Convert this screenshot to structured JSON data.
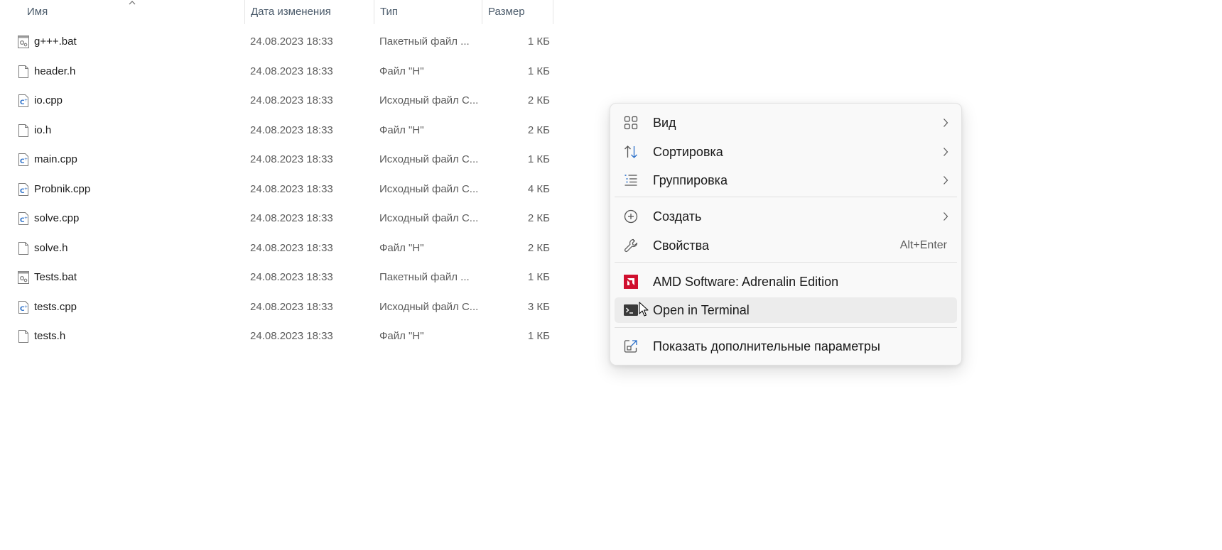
{
  "columns": {
    "name": "Имя",
    "date": "Дата изменения",
    "type": "Тип",
    "size": "Размер"
  },
  "files": [
    {
      "name": "g+++.bat",
      "date": "24.08.2023 18:33",
      "type": "Пакетный файл ...",
      "size": "1 КБ",
      "icon": "batch-file-icon"
    },
    {
      "name": "header.h",
      "date": "24.08.2023 18:33",
      "type": "Файл \"H\"",
      "size": "1 КБ",
      "icon": "blank-file-icon"
    },
    {
      "name": "io.cpp",
      "date": "24.08.2023 18:33",
      "type": "Исходный файл C...",
      "size": "2 КБ",
      "icon": "cpp-file-icon"
    },
    {
      "name": "io.h",
      "date": "24.08.2023 18:33",
      "type": "Файл \"H\"",
      "size": "2 КБ",
      "icon": "blank-file-icon"
    },
    {
      "name": "main.cpp",
      "date": "24.08.2023 18:33",
      "type": "Исходный файл C...",
      "size": "1 КБ",
      "icon": "cpp-file-icon"
    },
    {
      "name": "Probnik.cpp",
      "date": "24.08.2023 18:33",
      "type": "Исходный файл C...",
      "size": "4 КБ",
      "icon": "cpp-file-icon"
    },
    {
      "name": "solve.cpp",
      "date": "24.08.2023 18:33",
      "type": "Исходный файл C...",
      "size": "2 КБ",
      "icon": "cpp-file-icon"
    },
    {
      "name": "solve.h",
      "date": "24.08.2023 18:33",
      "type": "Файл \"H\"",
      "size": "2 КБ",
      "icon": "blank-file-icon"
    },
    {
      "name": "Tests.bat",
      "date": "24.08.2023 18:33",
      "type": "Пакетный файл ...",
      "size": "1 КБ",
      "icon": "batch-file-icon"
    },
    {
      "name": "tests.cpp",
      "date": "24.08.2023 18:33",
      "type": "Исходный файл C...",
      "size": "3 КБ",
      "icon": "cpp-file-icon"
    },
    {
      "name": "tests.h",
      "date": "24.08.2023 18:33",
      "type": "Файл \"H\"",
      "size": "1 КБ",
      "icon": "blank-file-icon"
    }
  ],
  "context_menu": {
    "items": [
      {
        "label": "Вид",
        "icon": "grid-view-icon",
        "submenu": true
      },
      {
        "label": "Сортировка",
        "icon": "sort-icon",
        "submenu": true
      },
      {
        "label": "Группировка",
        "icon": "group-list-icon",
        "submenu": true
      },
      {
        "label": "Создать",
        "icon": "plus-circle-icon",
        "submenu": true
      },
      {
        "label": "Свойства",
        "icon": "wrench-icon",
        "shortcut": "Alt+Enter"
      },
      {
        "label": "AMD Software: Adrenalin Edition",
        "icon": "amd-logo-icon"
      },
      {
        "label": "Open in Terminal",
        "icon": "terminal-icon",
        "hovered": true
      },
      {
        "label": "Показать дополнительные параметры",
        "icon": "share-external-icon"
      }
    ]
  },
  "colors": {
    "accent": "#2a6fc9",
    "amd_red": "#d0102f",
    "menu_bg": "#f9f9f9",
    "hover_bg": "#ececec"
  }
}
